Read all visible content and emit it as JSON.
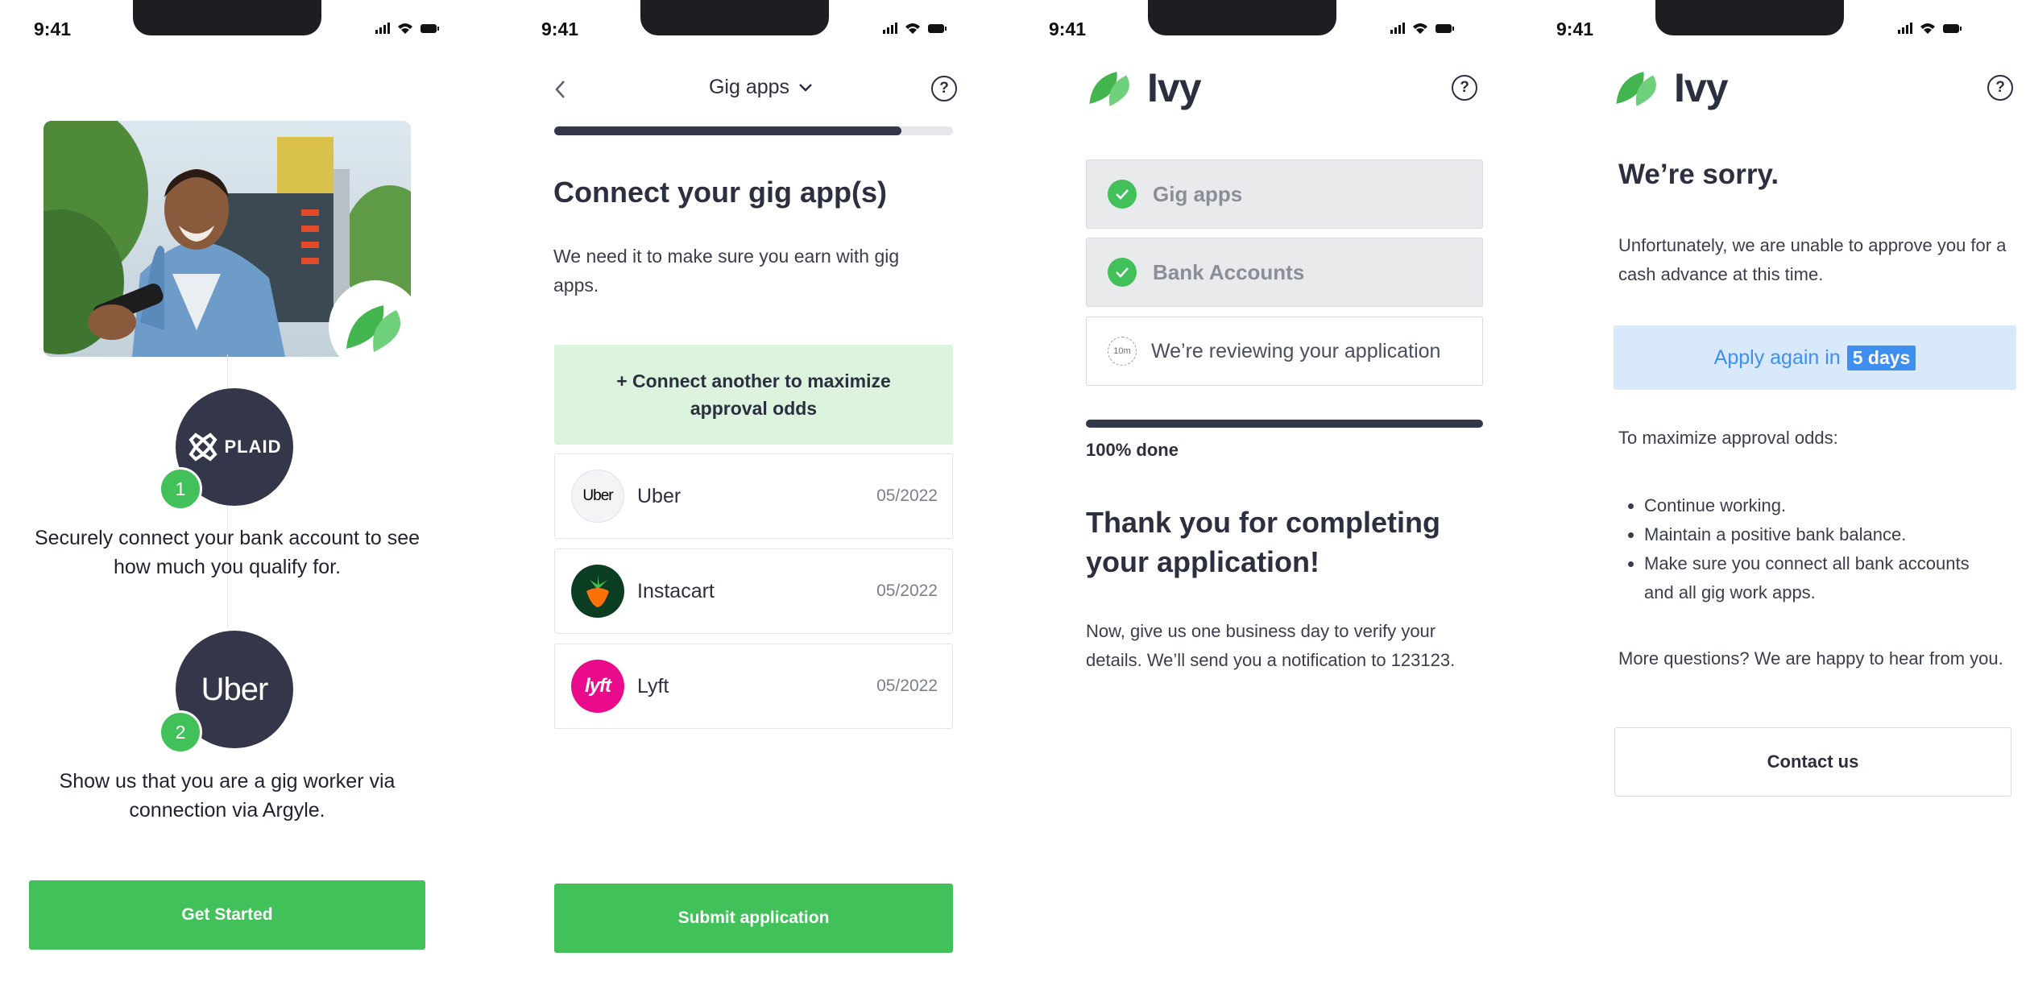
{
  "status_bar": {
    "time": "9:41"
  },
  "colors": {
    "green": "#42c15a",
    "dark": "#33374a",
    "light_green": "#dcf3de",
    "light_blue": "#d8e9fc",
    "blue": "#3f8ff0"
  },
  "screen1": {
    "badge": {
      "plaid_logo": "PLAID",
      "uber_logo": "Uber"
    },
    "step1": {
      "number": "1",
      "text": "Securely connect your bank account to see how much you qualify for."
    },
    "step2": {
      "number": "2",
      "text": "Show us that you are a gig worker via connection via Argyle."
    },
    "cta": "Get Started"
  },
  "screen2": {
    "header_title": "Gig apps",
    "progress": 0.87,
    "title": "Connect your gig app(s)",
    "subtitle": "We need it to make sure you earn with gig apps.",
    "connect_another": "+ Connect another to maximize approval odds",
    "apps": [
      {
        "name": "Uber",
        "date": "05/2022",
        "logo": "Uber"
      },
      {
        "name": "Instacart",
        "date": "05/2022",
        "logo": ""
      },
      {
        "name": "Lyft",
        "date": "05/2022",
        "logo": "lyft"
      }
    ],
    "submit": "Submit application"
  },
  "screen3": {
    "brand": "Ivy",
    "steps": [
      {
        "label": "Gig apps",
        "state": "done"
      },
      {
        "label": "Bank Accounts",
        "state": "done"
      },
      {
        "label": "We’re reviewing your application",
        "state": "pending",
        "timer": "10m"
      }
    ],
    "progress_label": "100% done",
    "progress": 1.0,
    "title": "Thank you for completing your application!",
    "body": "Now, give us one business day to verify your details. We’ll send you a notification to 123123."
  },
  "screen4": {
    "brand": "Ivy",
    "title": "We’re sorry.",
    "body": "Unfortunately, we are unable to approve you for a cash advance at this time.",
    "apply_prefix": "Apply again in",
    "apply_days": "5 days",
    "tips_heading": "To maximize approval odds:",
    "tips": [
      "Continue working.",
      "Maintain a positive bank balance.",
      "Make sure you connect all bank accounts and all gig work apps."
    ],
    "more_questions": "More questions? We are happy to hear from you.",
    "contact": "Contact us"
  }
}
